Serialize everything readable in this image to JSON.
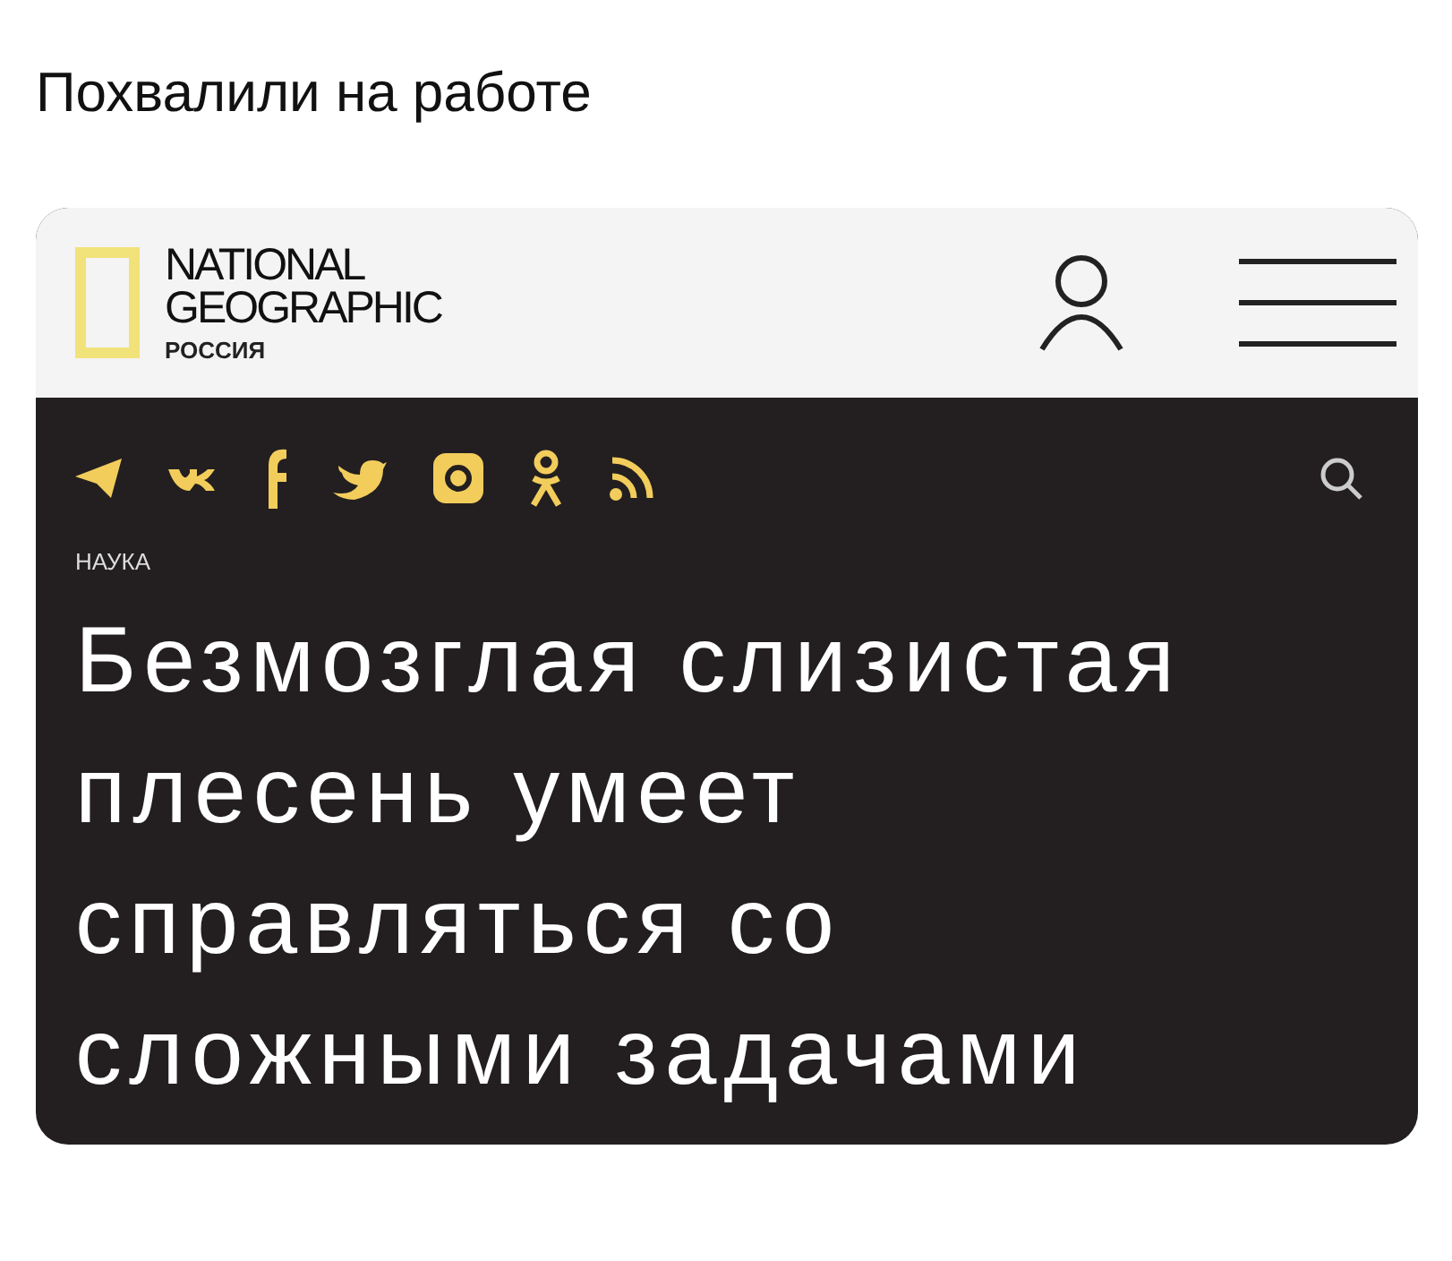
{
  "caption": "Похвалили на работе",
  "header": {
    "logo_lines": [
      "NATIONAL",
      "GEOGRAPHIC"
    ],
    "logo_sub": "РОССИЯ"
  },
  "article": {
    "category": "НАУКА",
    "headline": "Безмозглая слизистая плесень умеет справляться со сложными задачами"
  }
}
